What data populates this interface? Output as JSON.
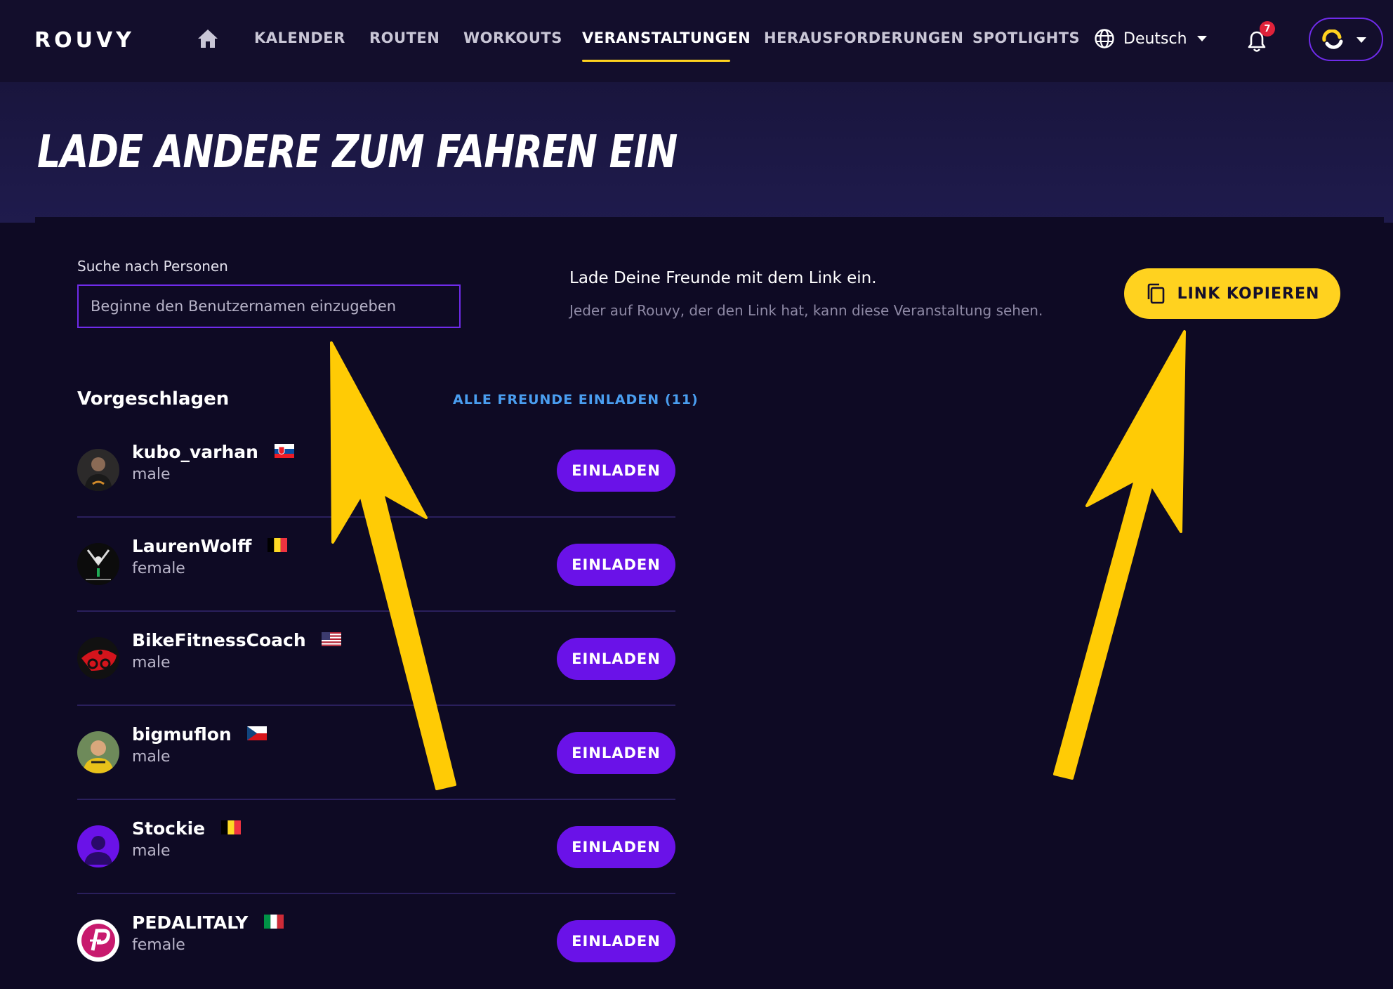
{
  "nav": {
    "logo": "ROUVY",
    "items": [
      {
        "label": "KALENDER"
      },
      {
        "label": "ROUTEN"
      },
      {
        "label": "WORKOUTS"
      },
      {
        "label": "VERANSTALTUNGEN"
      },
      {
        "label": "HERAUSFORDERUNGEN"
      },
      {
        "label": "SPOTLIGHTS"
      }
    ],
    "active": "VERANSTALTUNGEN",
    "language": "Deutsch",
    "notification_count": "7"
  },
  "page": {
    "title": "LADE ANDERE ZUM FAHREN EIN"
  },
  "search": {
    "label": "Suche nach Personen",
    "placeholder": "Beginne den Benutzernamen einzugeben"
  },
  "link_invite": {
    "title": "Lade Deine Freunde mit dem Link ein.",
    "subtitle": "Jeder auf Rouvy, der den Link hat, kann diese Veranstaltung sehen.",
    "button": "LINK KOPIEREN"
  },
  "suggested": {
    "title": "Vorgeschlagen",
    "invite_all": "ALLE FREUNDE EINLADEN (11)",
    "invite_label": "EINLADEN",
    "users": [
      {
        "name": "kubo_varhan",
        "gender": "male",
        "flag": "slovakia"
      },
      {
        "name": "LaurenWolff",
        "gender": "female",
        "flag": "belgium"
      },
      {
        "name": "BikeFitnessCoach",
        "gender": "male",
        "flag": "usa"
      },
      {
        "name": "bigmuflon",
        "gender": "male",
        "flag": "czechia"
      },
      {
        "name": "Stockie",
        "gender": "male",
        "flag": "belgium"
      },
      {
        "name": "PEDALITALY",
        "gender": "female",
        "flag": "italy"
      }
    ]
  },
  "colors": {
    "accent_yellow": "#ffd21f",
    "accent_purple": "#6a12e8",
    "link_blue": "#4a9ef0",
    "background": "#0e0a24"
  }
}
